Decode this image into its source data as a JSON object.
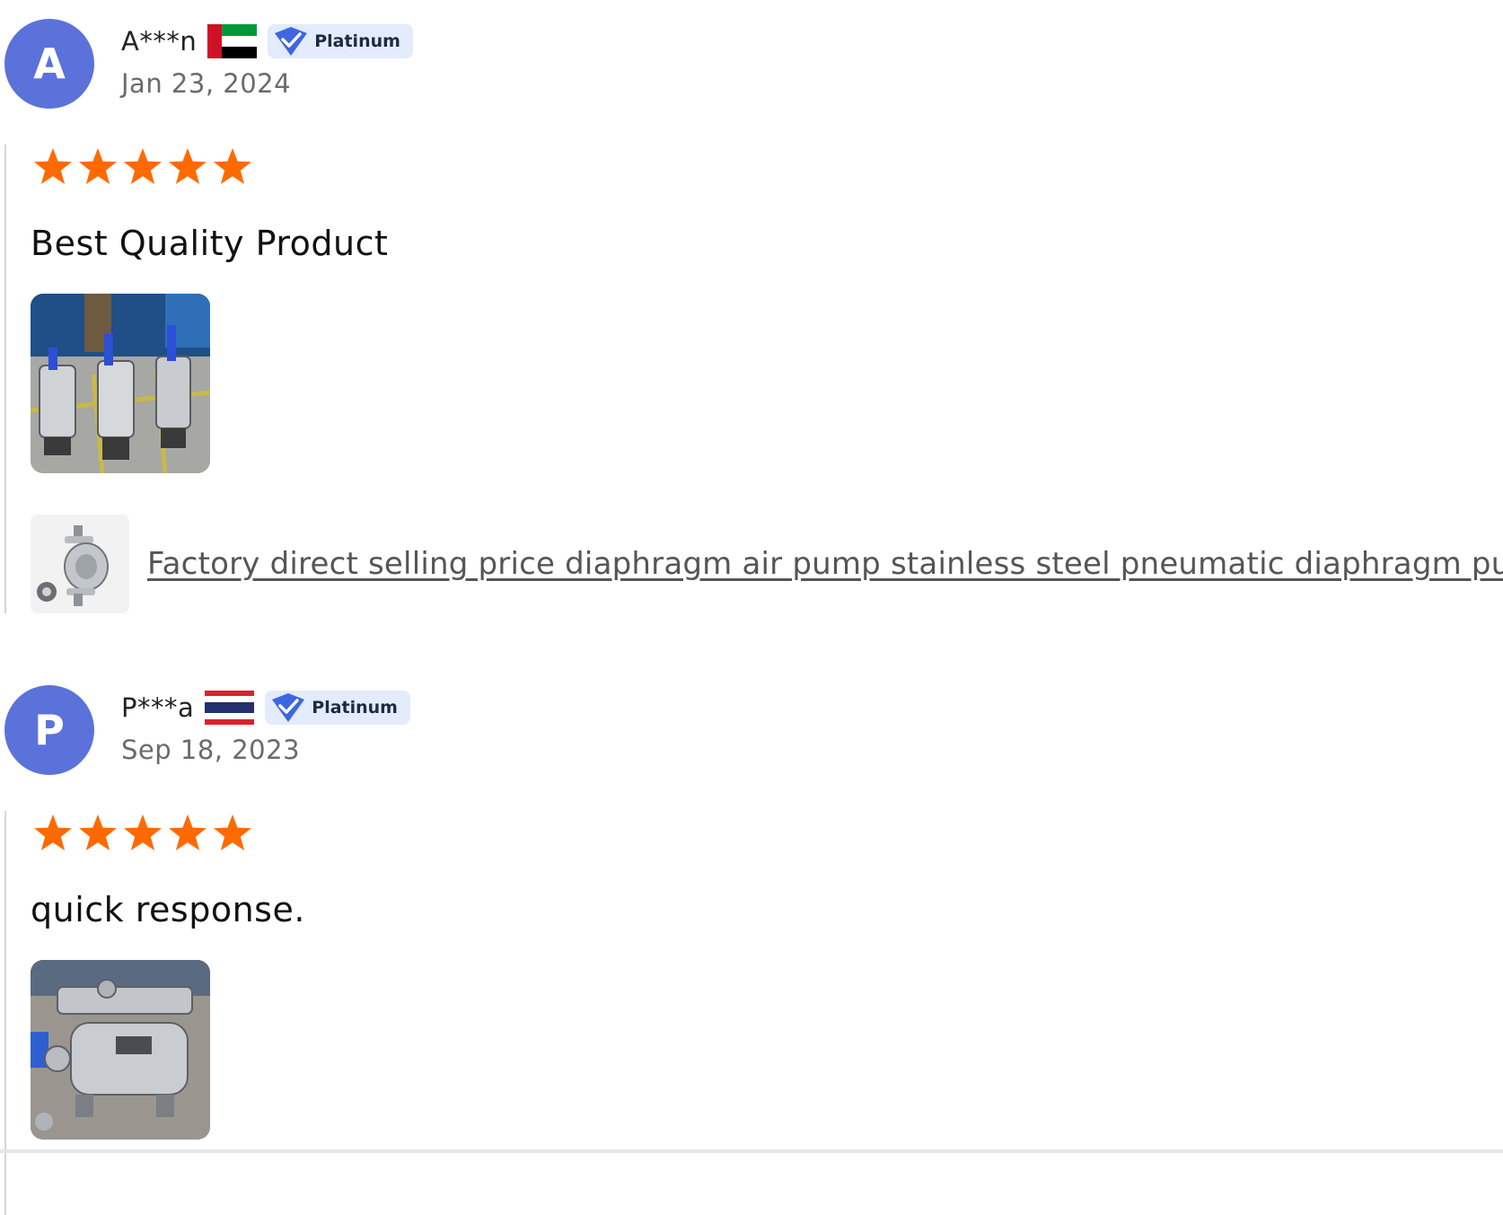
{
  "colors": {
    "avatar_bg": "#5b72db",
    "star": "#ff6a00",
    "badge_bg": "#e3ebfc",
    "badge_check": "#3d67e0",
    "link": "#555555",
    "date": "#6b6b6b"
  },
  "reviews": [
    {
      "avatar_letter": "A",
      "username": "A***n",
      "flag_icon": "uae-flag-icon",
      "badge_label": "Platinum",
      "date": "Jan 23, 2024",
      "rating": 5,
      "text": "Best Quality Product",
      "photo_icon": "pump-photo-icon",
      "product_link": "Factory direct selling price diaphragm air pump stainless steel pneumatic diaphragm pump"
    },
    {
      "avatar_letter": "P",
      "username": "P***a",
      "flag_icon": "thailand-flag-icon",
      "badge_label": "Platinum",
      "date": "Sep 18, 2023",
      "rating": 5,
      "text": "quick response.",
      "photo_icon": "pump-photo-icon"
    }
  ]
}
